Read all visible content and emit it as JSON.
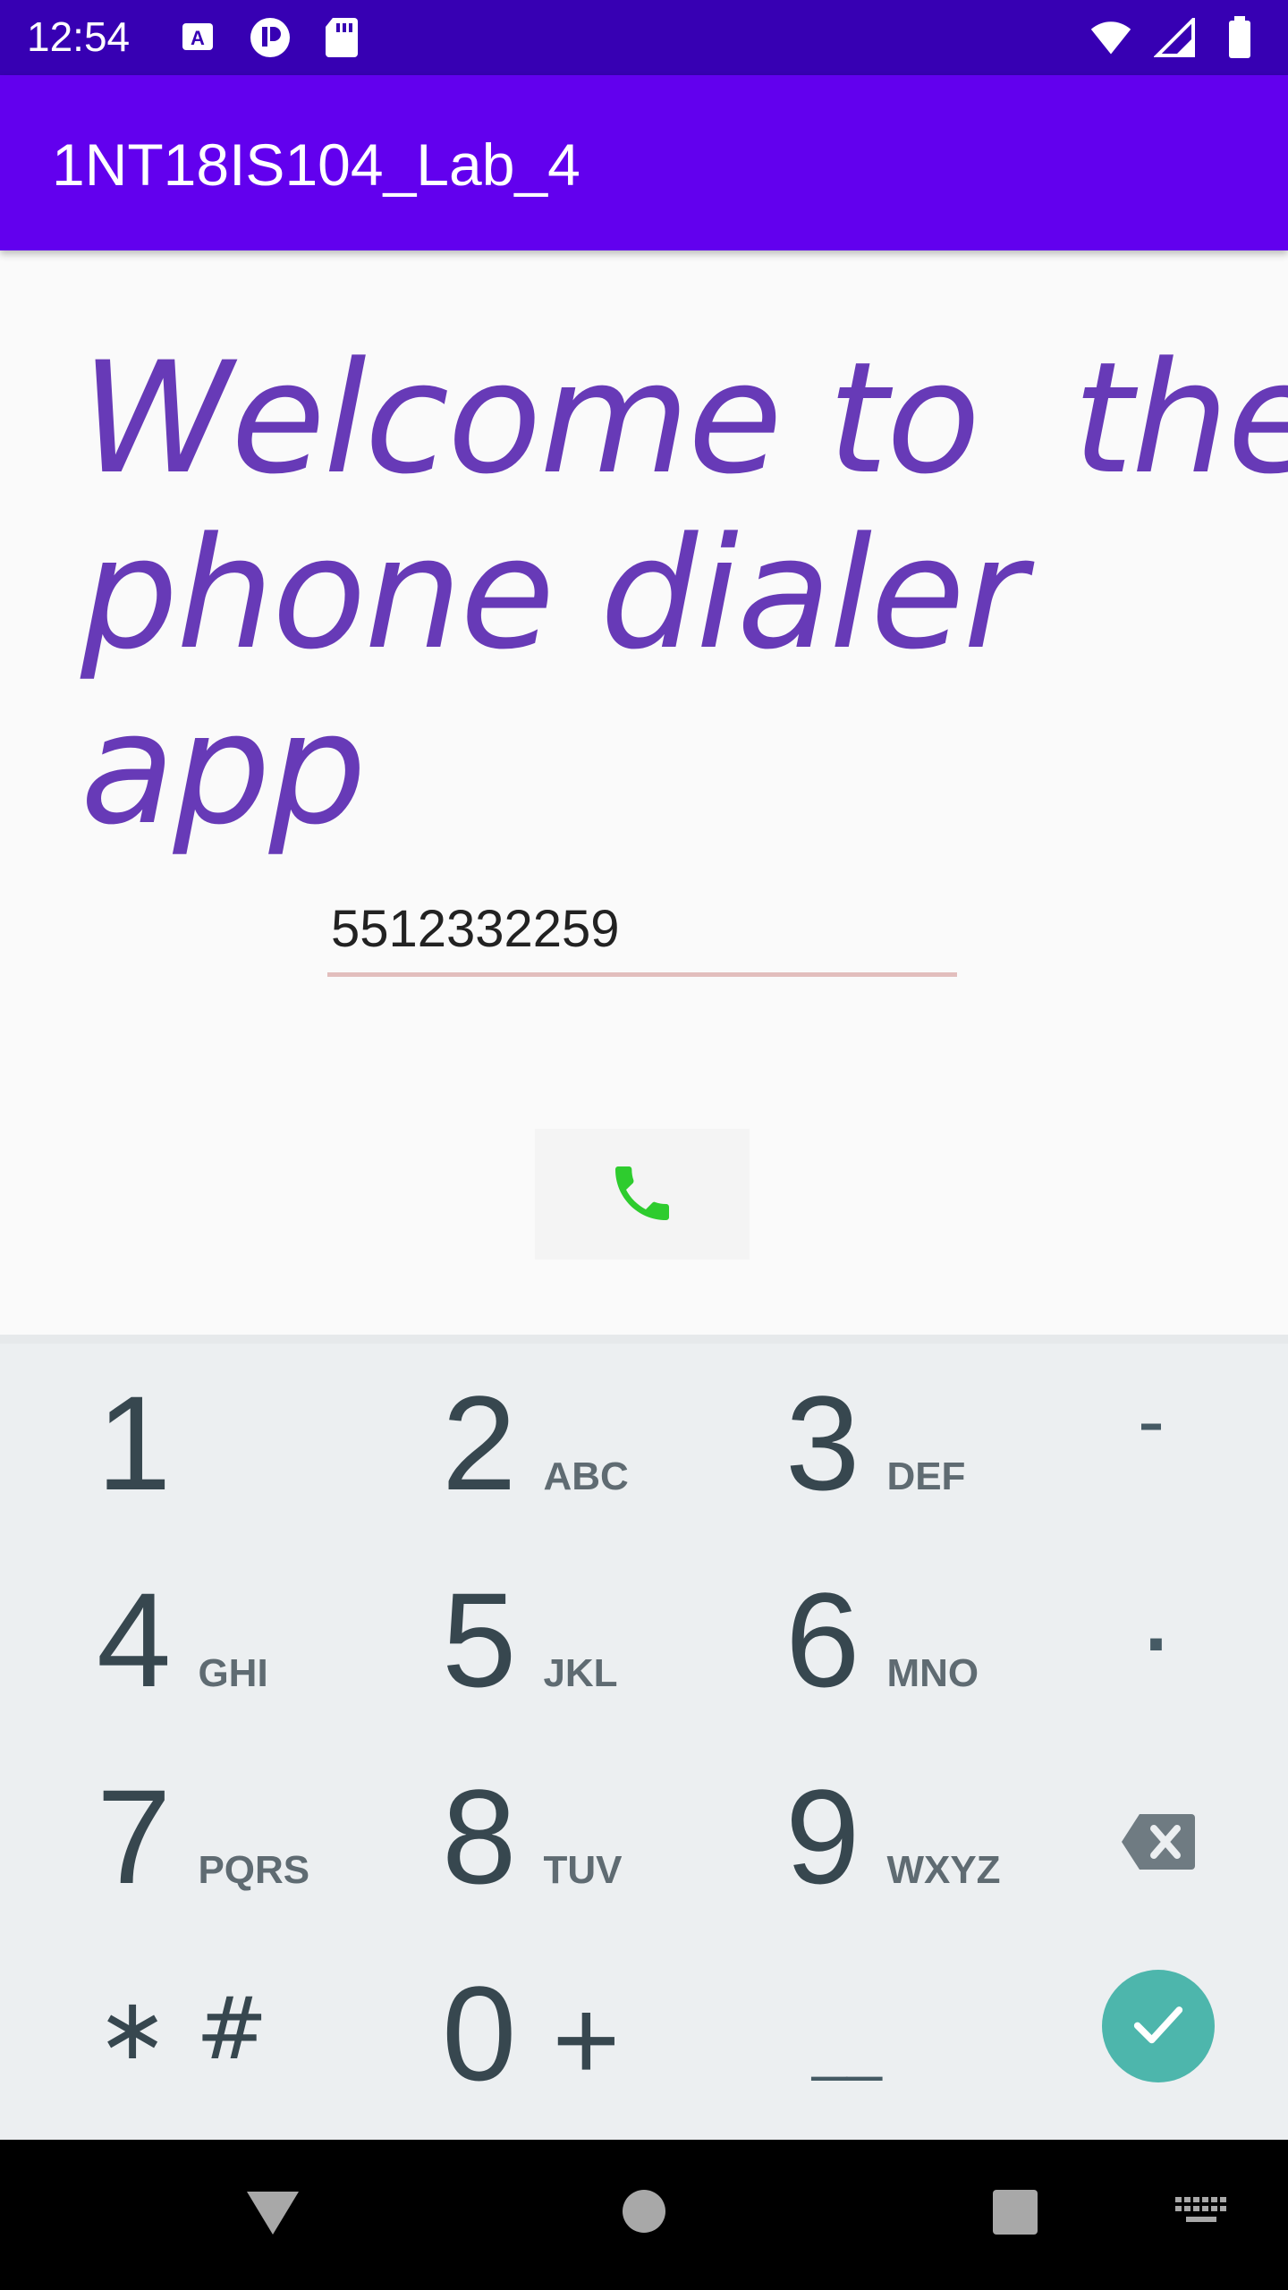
{
  "status_bar": {
    "time": "12:54"
  },
  "app_bar": {
    "title": "1NT18IS104_Lab_4"
  },
  "main": {
    "welcome_line1": "Welcome to  the",
    "welcome_line2": "phone dialer app",
    "phone_value": "5512332259"
  },
  "keypad": {
    "rows": [
      [
        {
          "digit": "1",
          "letters": ""
        },
        {
          "digit": "2",
          "letters": "ABC"
        },
        {
          "digit": "3",
          "letters": "DEF"
        }
      ],
      [
        {
          "digit": "4",
          "letters": "GHI"
        },
        {
          "digit": "5",
          "letters": "JKL"
        },
        {
          "digit": "6",
          "letters": "MNO"
        }
      ],
      [
        {
          "digit": "7",
          "letters": "PQRS"
        },
        {
          "digit": "8",
          "letters": "TUV"
        },
        {
          "digit": "9",
          "letters": "WXYZ"
        }
      ]
    ],
    "star_hash": "∗ #",
    "zero": "0",
    "plus": "+",
    "minus": "-",
    "period": ".",
    "underscore": "__"
  },
  "colors": {
    "status_bar": "#3700b3",
    "app_bar": "#6200ee",
    "welcome_text": "#673ab7",
    "call_icon": "#2ecc2e",
    "done_button": "#4db6ac",
    "keypad_bg": "#eceff1"
  }
}
